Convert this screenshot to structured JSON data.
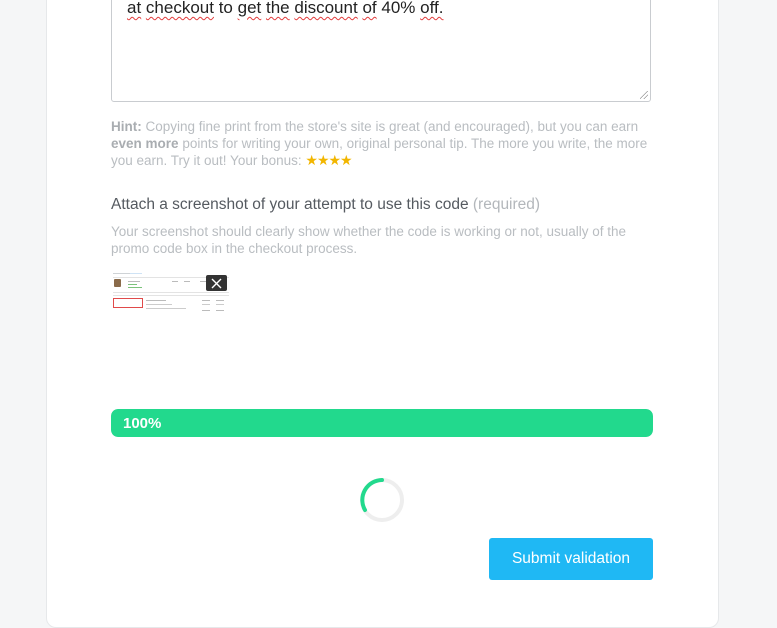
{
  "form": {
    "tip_text_visible_line": [
      "at",
      "checkout",
      "to",
      "get",
      "the",
      "discount",
      "of",
      "40%",
      "off."
    ],
    "hint_label": "Hint:",
    "hint_text": "Copying fine print from the store's site is great (and encouraged), but you can earn",
    "hint_text_bold": "even more",
    "hint_text_rest": "points for writing your own, original personal tip. The more you write, the more you earn. Try it out! Your bonus:",
    "bonus_stars": "★★★★",
    "bonus_star_count": 4,
    "attach_title": "Attach a screenshot of your attempt to use this code",
    "attach_required": "(required)",
    "attach_description": "Your screenshot should clearly show whether the code is working or not, usually of the promo code box in the checkout process.",
    "upload_progress_label": "100%",
    "upload_progress_value": 100,
    "submit_label": "Submit validation"
  },
  "colors": {
    "progress": "#22d98d",
    "button": "#1fb8f4",
    "star": "#f2b600",
    "spell_error": "#e23b3b"
  }
}
